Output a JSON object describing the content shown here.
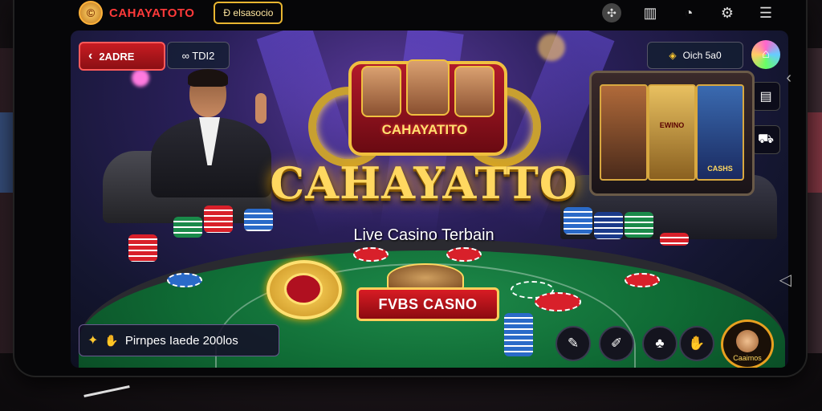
{
  "app": {
    "brand": "CAHAYATOTO",
    "top_button": "Ð elsasocio"
  },
  "game": {
    "back_label": "2ADRE",
    "mode_label": "∞ TDI2",
    "volume_label": "Oich 5a0",
    "emblem_text": "CAHAYATITO",
    "title": "CAHAYATTO",
    "subtitle": "Live Casino Terbain",
    "cta_label": "FVBS CASNO",
    "promo_label": "Pirnpes Iaede 200los",
    "avatar_label": "Caaimos",
    "slot_reel_labels": [
      "",
      "EWINO",
      "CASHS"
    ]
  },
  "icons": {
    "top": [
      "grid-icon",
      "signal-icon",
      "broadcast-icon",
      "settings-icon",
      "hamburger-menu-icon"
    ],
    "actions": [
      "chat-icon",
      "pen-icon",
      "cards-icon",
      "hand-icon"
    ]
  },
  "colors": {
    "accent_gold": "#ffd860",
    "accent_red": "#c81c22",
    "felt_green": "#1e8a4a"
  }
}
